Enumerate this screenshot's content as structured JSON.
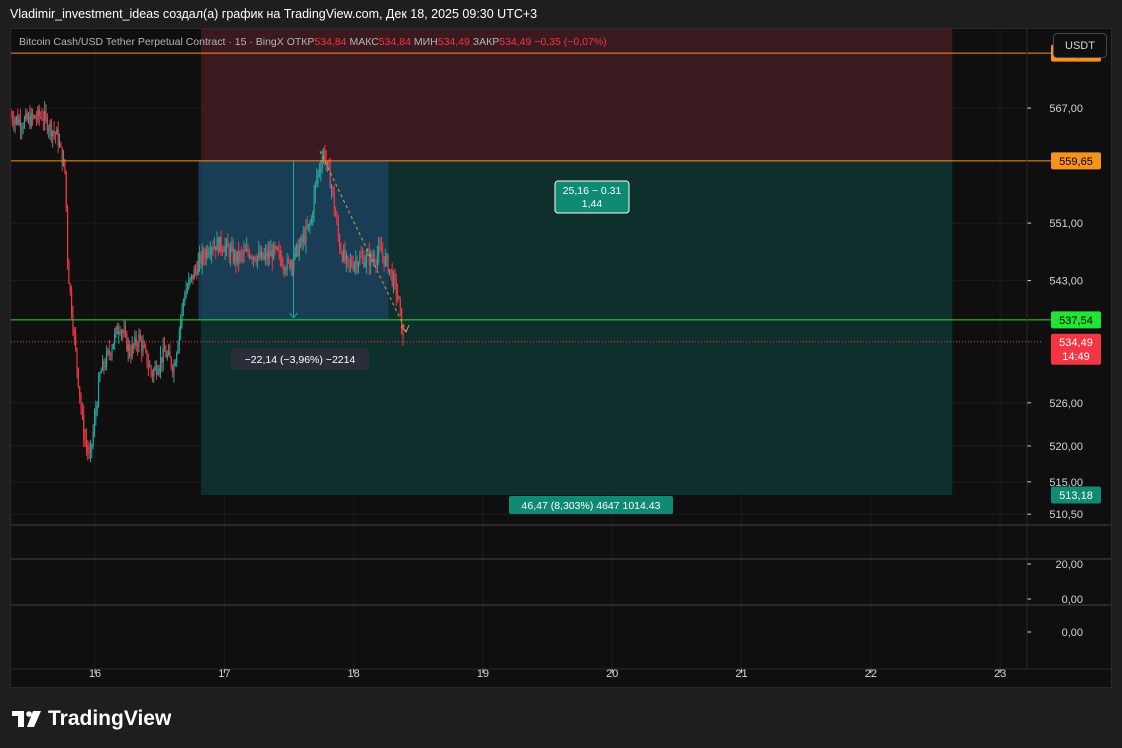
{
  "topbar": {
    "title": "Vladimir_investment_ideas создал(а) график на TradingView.com, Дек 18, 2025 09:30 UTC+3"
  },
  "legend": {
    "symbol": "Bitcoin Cash/USD Tether Perpetual Contract · 15 · BingX",
    "open_label": "ОТКР",
    "open": "534,84",
    "high_label": "МАКС",
    "high": "534,84",
    "low_label": "МИН",
    "low": "534,49",
    "close_label": "ЗАКР",
    "close": "534,49",
    "change": "−0,35 (−0,07%)"
  },
  "currency_button": "USDT",
  "footer": {
    "brand": "TradingView"
  },
  "colors": {
    "up": "#26a69a",
    "down": "#f23645",
    "orange": "#f7931a",
    "green_line": "#22e533",
    "stop_zone": "#3a1a1e",
    "target_zone": "#0e2f2b",
    "measure_zone": "#1a3f5c"
  },
  "chart_data": {
    "type": "candlestick",
    "symbol": "Bitcoin Cash/USD Tether Perpetual Contract",
    "interval": "15",
    "exchange": "BingX",
    "ylim": [
      509,
      578
    ],
    "xlim": [
      15.35,
      23.2
    ],
    "x_ticks": [
      "16",
      "17",
      "18",
      "19",
      "20",
      "21",
      "22",
      "23"
    ],
    "y_ticks": [
      "567,00",
      "551,00",
      "543,00",
      "526,00",
      "520,00",
      "515,00",
      "510,50"
    ],
    "price_path": [
      [
        15.35,
        566
      ],
      [
        15.45,
        565
      ],
      [
        15.6,
        566
      ],
      [
        15.72,
        563
      ],
      [
        15.78,
        558
      ],
      [
        15.8,
        545
      ],
      [
        15.85,
        535
      ],
      [
        15.92,
        522
      ],
      [
        15.97,
        518
      ],
      [
        16.05,
        530
      ],
      [
        16.12,
        533
      ],
      [
        16.2,
        537
      ],
      [
        16.28,
        533
      ],
      [
        16.35,
        535
      ],
      [
        16.45,
        530
      ],
      [
        16.55,
        533
      ],
      [
        16.62,
        531
      ],
      [
        16.7,
        541
      ],
      [
        16.8,
        545
      ],
      [
        16.9,
        548
      ],
      [
        17.0,
        548
      ],
      [
        17.1,
        546
      ],
      [
        17.2,
        547
      ],
      [
        17.3,
        546
      ],
      [
        17.4,
        547
      ],
      [
        17.5,
        545
      ],
      [
        17.6,
        548
      ],
      [
        17.68,
        551
      ],
      [
        17.72,
        557
      ],
      [
        17.78,
        561
      ],
      [
        17.84,
        556
      ],
      [
        17.9,
        548
      ],
      [
        17.96,
        545
      ],
      [
        18.05,
        546
      ],
      [
        18.15,
        546
      ],
      [
        18.22,
        547
      ],
      [
        18.28,
        545
      ],
      [
        18.35,
        541
      ],
      [
        18.38,
        537
      ],
      [
        18.39,
        534.49
      ]
    ],
    "horizontal_levels": [
      {
        "label": "574,64",
        "value": 574.64,
        "color": "#f7931a"
      },
      {
        "label": "559,65",
        "value": 559.65,
        "color": "#f7931a"
      },
      {
        "label": "537,54",
        "value": 537.54,
        "color": "#22e533"
      }
    ],
    "last_price": {
      "label": "534,49",
      "value": 534.49,
      "timer": "14:49"
    },
    "target_label": {
      "label": "513,18",
      "value": 513.18
    },
    "position": {
      "type": "short",
      "entry": 559.65,
      "stop": 583,
      "target": 513.18,
      "x_start": 16.82,
      "x_end": 22.63,
      "info_top": [
        "25,16 ~ 0.31",
        "1,44"
      ],
      "info_bottom": "46,47 (8,303%) 4647 1014.43"
    },
    "measure": {
      "x_start": 16.8,
      "x_end": 18.27,
      "top": 559.65,
      "bottom": 537.54,
      "label": "−22,14 (−3,96%) −2214"
    },
    "indicator_panes": [
      {
        "ticks": [
          "20,00"
        ]
      },
      {
        "ticks": [
          "0,00"
        ]
      },
      {
        "ticks": [
          "0,00"
        ]
      }
    ]
  }
}
